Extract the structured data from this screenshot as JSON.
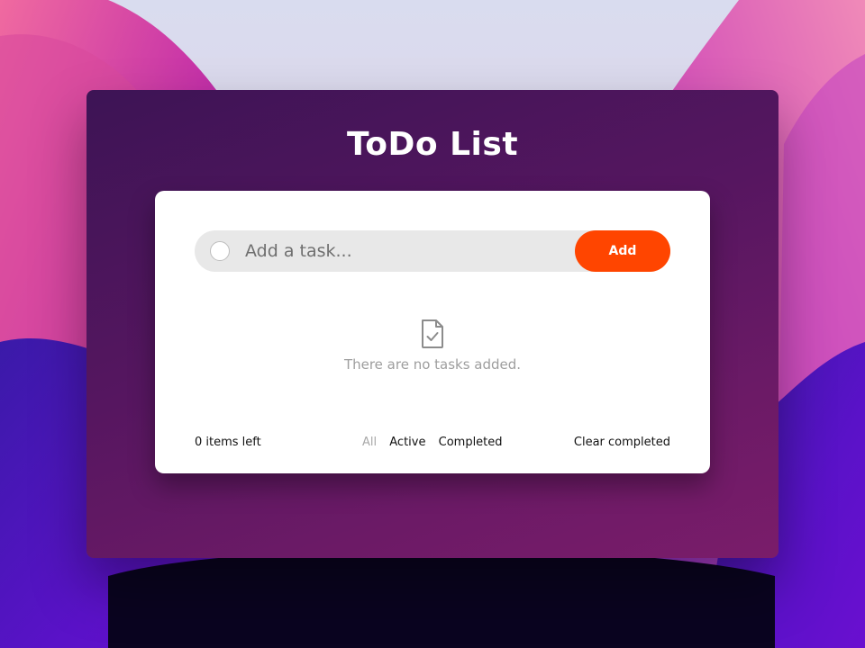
{
  "app": {
    "title": "ToDo List"
  },
  "input": {
    "placeholder": "Add a task...",
    "value": ""
  },
  "add_button": {
    "label": "Add"
  },
  "empty_state": {
    "icon": "file-check-icon",
    "text": "There are no tasks added."
  },
  "footer": {
    "items_left": "0 items left",
    "filters": [
      {
        "label": "All",
        "selected": true
      },
      {
        "label": "Active",
        "selected": false
      },
      {
        "label": "Completed",
        "selected": false
      }
    ],
    "clear_completed": "Clear completed"
  },
  "colors": {
    "accent": "#ff4500",
    "window_gradient_start": "#3d1455",
    "window_gradient_end": "#7a1c6a",
    "card": "#ffffff",
    "input_bg": "#e8e8e8",
    "muted_text": "#9e9e9e"
  }
}
